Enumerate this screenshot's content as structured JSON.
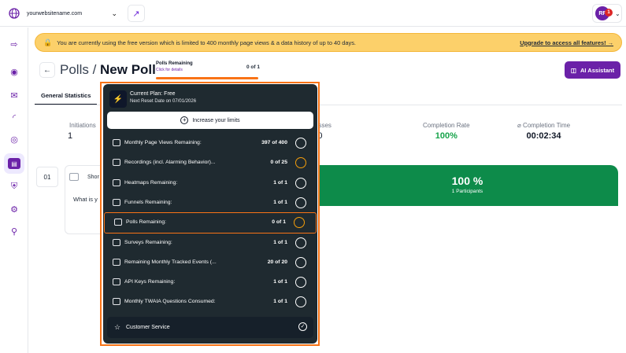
{
  "topbar": {
    "website": "yourwebsitename.com",
    "avatar_initials": "RF",
    "notification_count": "1"
  },
  "banner": {
    "message": "You are currently using the free version which is limited to 400 monthly page views & a data history of up to 40 days.",
    "upgrade_link": "Upgrade to access all features! →"
  },
  "header": {
    "title_prefix": "Polls / ",
    "title_main": "New Poll",
    "polls_remaining_label": "Polls Remaining",
    "polls_remaining_sub": "Click for details",
    "polls_remaining_count": "0 of 1",
    "ai_button": "AI Assistant"
  },
  "tabs": {
    "general": "General Statistics"
  },
  "stats": [
    {
      "label": "Initiations",
      "value": "1"
    },
    {
      "label": "smisses",
      "value": "0"
    },
    {
      "label": "Completion Rate",
      "value": "100%"
    },
    {
      "label": "⌀ Completion Time",
      "value": "00:02:34"
    }
  ],
  "question": {
    "number": "01",
    "type_short": "Shor",
    "text_short": "What is y",
    "result_pct": "100 %",
    "participants": "1 Participants"
  },
  "popup": {
    "plan_title": "Current Plan: Free",
    "reset_date": "Next Reset Date on 07/01/2026",
    "increase_button": "Increase your limits",
    "rows": [
      {
        "label": "Monthly Page Views Remaining:",
        "value": "397 of 400",
        "status": "ok",
        "icon": "page-views-icon"
      },
      {
        "label": "Recordings (incl. Alarming Behavior)...",
        "value": "0 of 25",
        "status": "warn",
        "icon": "recordings-icon"
      },
      {
        "label": "Heatmaps Remaining:",
        "value": "1 of 1",
        "status": "ok",
        "icon": "heatmaps-icon"
      },
      {
        "label": "Funnels Remaining:",
        "value": "1 of 1",
        "status": "ok",
        "icon": "funnels-icon"
      },
      {
        "label": "Polls Remaining:",
        "value": "0 of 1",
        "status": "warn",
        "icon": "polls-icon"
      },
      {
        "label": "Surveys Remaining:",
        "value": "1 of 1",
        "status": "ok",
        "icon": "surveys-icon"
      },
      {
        "label": "Remaining Monthly Tracked Events (...",
        "value": "20 of 20",
        "status": "ok",
        "icon": "events-icon"
      },
      {
        "label": "API Keys Remaining:",
        "value": "1 of 1",
        "status": "ok",
        "icon": "api-keys-icon"
      },
      {
        "label": "Monthly TWAIA Questions Consumed:",
        "value": "1 of 1",
        "status": "ok",
        "icon": "twaia-icon"
      }
    ],
    "customer_service": "Customer Service"
  }
}
